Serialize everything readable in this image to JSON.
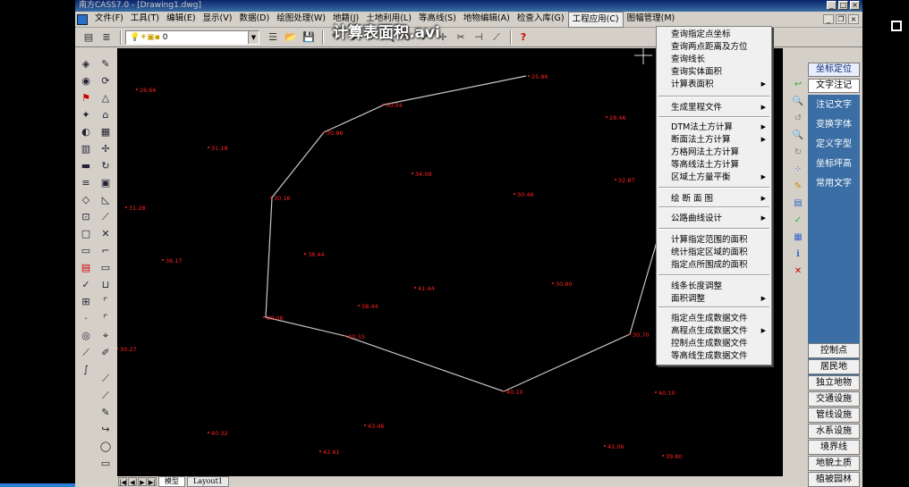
{
  "window": {
    "title": "南方CASS7.0 - [Drawing1.dwg]",
    "video_overlay": "计算表面积.avi"
  },
  "menubar": {
    "items": [
      "文件(F)",
      "工具(T)",
      "编辑(E)",
      "显示(V)",
      "数据(D)",
      "绘图处理(W)",
      "地籍(J)",
      "土地利用(L)",
      "等高线(S)",
      "地物编辑(A)",
      "检查入库(G)",
      "工程应用(C)",
      "图幅管理(M)"
    ],
    "active": "工程应用(C)"
  },
  "toolbar": {
    "layer_value": "0"
  },
  "dropdown": {
    "items": [
      {
        "label": "查询指定点坐标",
        "arrow": false
      },
      {
        "label": "查询两点距离及方位",
        "arrow": false
      },
      {
        "label": "查询线长",
        "arrow": false
      },
      {
        "label": "查询实体面积",
        "arrow": false
      },
      {
        "label": "计算表面积",
        "arrow": true
      },
      {
        "label": "生成里程文件",
        "arrow": true
      },
      {
        "label": "DTM法土方计算",
        "arrow": true
      },
      {
        "label": "断面法土方计算",
        "arrow": true
      },
      {
        "label": "方格网法土方计算",
        "arrow": false
      },
      {
        "label": "等高线法土方计算",
        "arrow": false
      },
      {
        "label": "区域土方量平衡",
        "arrow": true
      },
      {
        "label": "绘 断 面 图",
        "arrow": true
      },
      {
        "label": "公路曲线设计",
        "arrow": true
      },
      {
        "label": "计算指定范围的面积",
        "arrow": false
      },
      {
        "label": "统计指定区域的面积",
        "arrow": false
      },
      {
        "label": "指定点所围成的面积",
        "arrow": false
      },
      {
        "label": "线条长度调整",
        "arrow": false
      },
      {
        "label": "面积调整",
        "arrow": true
      },
      {
        "label": "指定点生成数据文件",
        "arrow": false
      },
      {
        "label": "高程点生成数据文件",
        "arrow": true
      },
      {
        "label": "控制点生成数据文件",
        "arrow": false
      },
      {
        "label": "等高线生成数据文件",
        "arrow": false
      }
    ]
  },
  "right_panel": {
    "headers": [
      "坐标定位",
      "文字注记"
    ],
    "selected_header": "坐标定位",
    "blue_items": [
      "注记文字",
      "变换字体",
      "定义字型",
      "坐标坪高",
      "常用文字"
    ],
    "categories": [
      "控制点",
      "居民地",
      "独立地物",
      "交通设施",
      "管线设施",
      "水系设施",
      "境界线",
      "地貌土质",
      "植被园林"
    ]
  },
  "tabs": {
    "items": [
      "模型",
      "Layout1"
    ],
    "active": "模型"
  },
  "canvas": {
    "polygon_color": "#c8c8c8",
    "label_color": "#ff2020",
    "points": [
      {
        "label": "26.66"
      },
      {
        "label": "25.86"
      },
      {
        "label": "30.04"
      },
      {
        "label": "30.86"
      },
      {
        "label": "30.16"
      },
      {
        "label": "29.06"
      },
      {
        "label": "40.33"
      },
      {
        "label": "40.10"
      },
      {
        "label": "30.70"
      },
      {
        "label": "38.44"
      },
      {
        "label": "34.08"
      },
      {
        "label": "30.46"
      },
      {
        "label": "32.87"
      },
      {
        "label": "28.46"
      },
      {
        "label": "31.18"
      },
      {
        "label": "31.28"
      },
      {
        "label": "36.17"
      },
      {
        "label": "38.44"
      },
      {
        "label": "41.44"
      },
      {
        "label": "30.80"
      },
      {
        "label": "30.27"
      },
      {
        "label": "40.32"
      },
      {
        "label": "43.46"
      },
      {
        "label": "42.61"
      },
      {
        "label": "41.06"
      },
      {
        "label": "40.10"
      },
      {
        "label": "39.80"
      }
    ]
  }
}
